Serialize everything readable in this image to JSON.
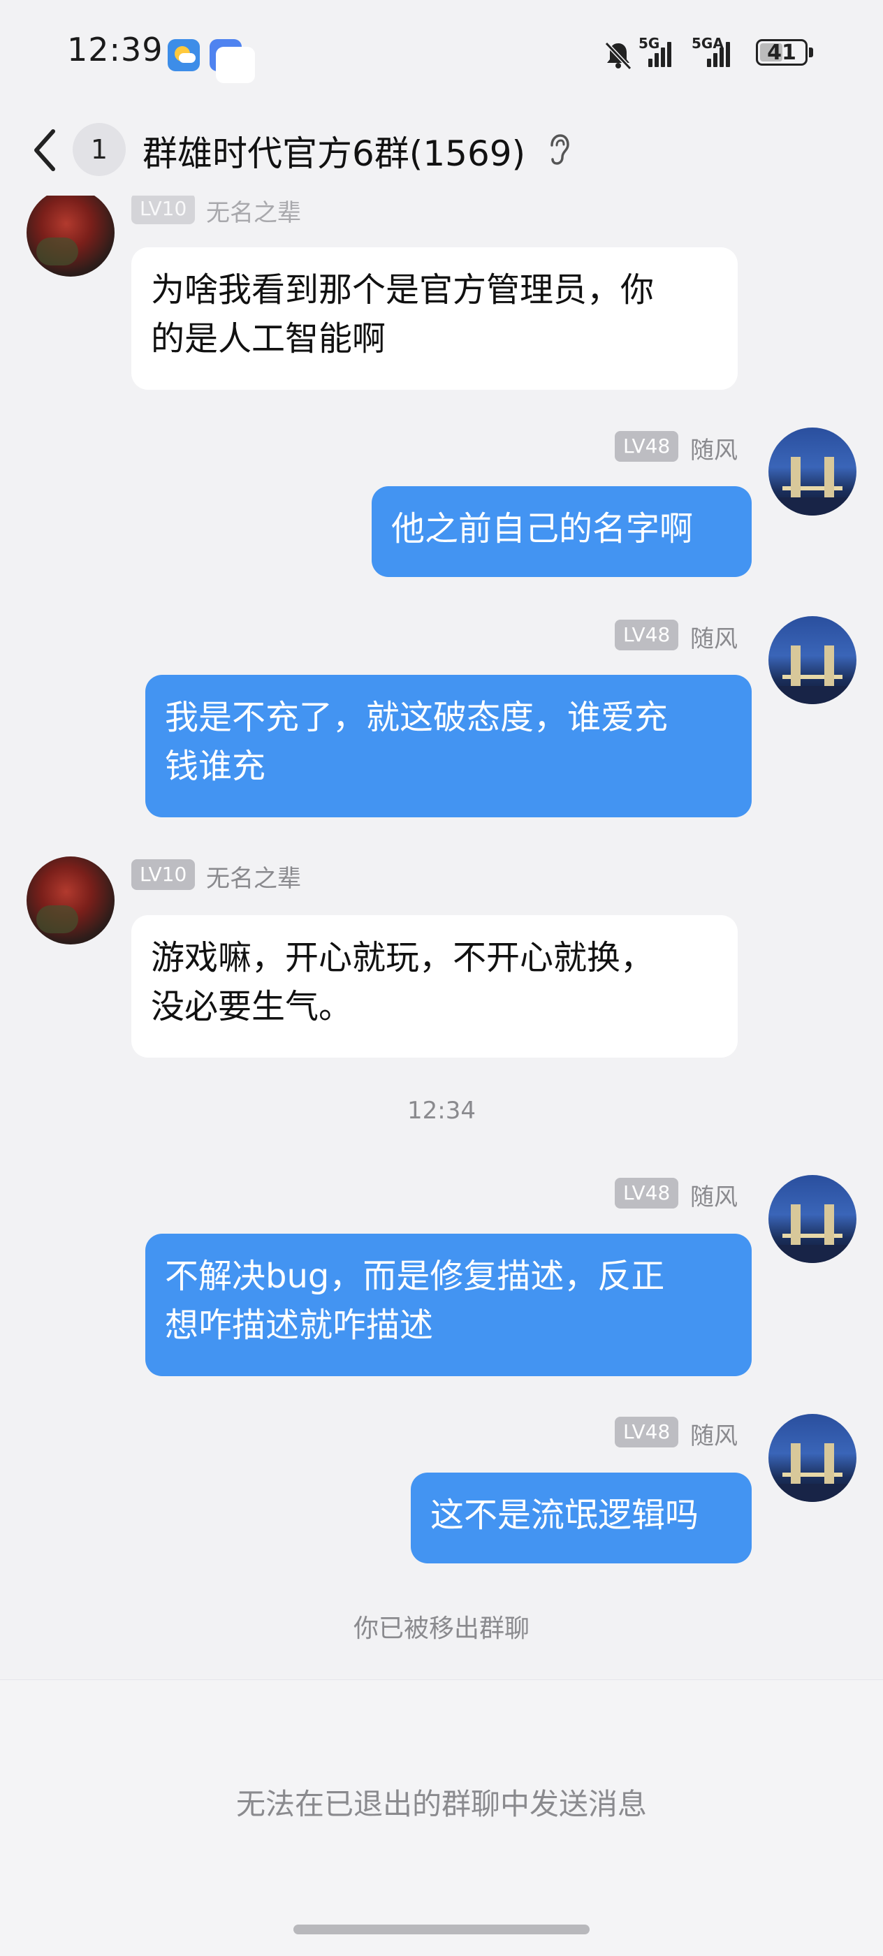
{
  "status_bar": {
    "time": "12:39",
    "network_1": "5G",
    "network_2": "5GA",
    "battery": "41",
    "icons": [
      "weather-app-icon",
      "messages-app-icon",
      "bell-off-icon",
      "signal-icon",
      "battery-icon"
    ]
  },
  "header": {
    "unread_count": "1",
    "title": "群雄时代官方6群(1569)",
    "icons": [
      "back-icon",
      "ear-icon"
    ]
  },
  "messages": [
    {
      "side": "in",
      "level": "LV10",
      "name": "无名之辈",
      "text_line1": "为啥我看到那个是官方管理员，你",
      "text_line2": "的是人工智能啊"
    },
    {
      "side": "out",
      "level": "LV48",
      "name": "随风",
      "text_line1": "他之前自己的名字啊"
    },
    {
      "side": "out",
      "level": "LV48",
      "name": "随风",
      "text_line1": "我是不充了，就这破态度，谁爱充",
      "text_line2": "钱谁充"
    },
    {
      "side": "in",
      "level": "LV10",
      "name": "无名之辈",
      "text_line1": "游戏嘛，开心就玩，不开心就换，",
      "text_line2": "没必要生气。"
    },
    {
      "side": "out",
      "level": "LV48",
      "name": "随风",
      "text_line1": "不解决bug，而是修复描述，反正",
      "text_line2": "想咋描述就咋描述"
    },
    {
      "side": "out",
      "level": "LV48",
      "name": "随风",
      "text_line1": "这不是流氓逻辑吗"
    }
  ],
  "time_separator": "12:34",
  "system_note": "你已被移出群聊",
  "input_disabled_text": "无法在已退出的群聊中发送消息",
  "colors": {
    "background": "#f2f2f4",
    "outgoing_bubble": "#4394f2",
    "incoming_bubble": "#ffffff",
    "level_badge": "#bdbdc2"
  }
}
